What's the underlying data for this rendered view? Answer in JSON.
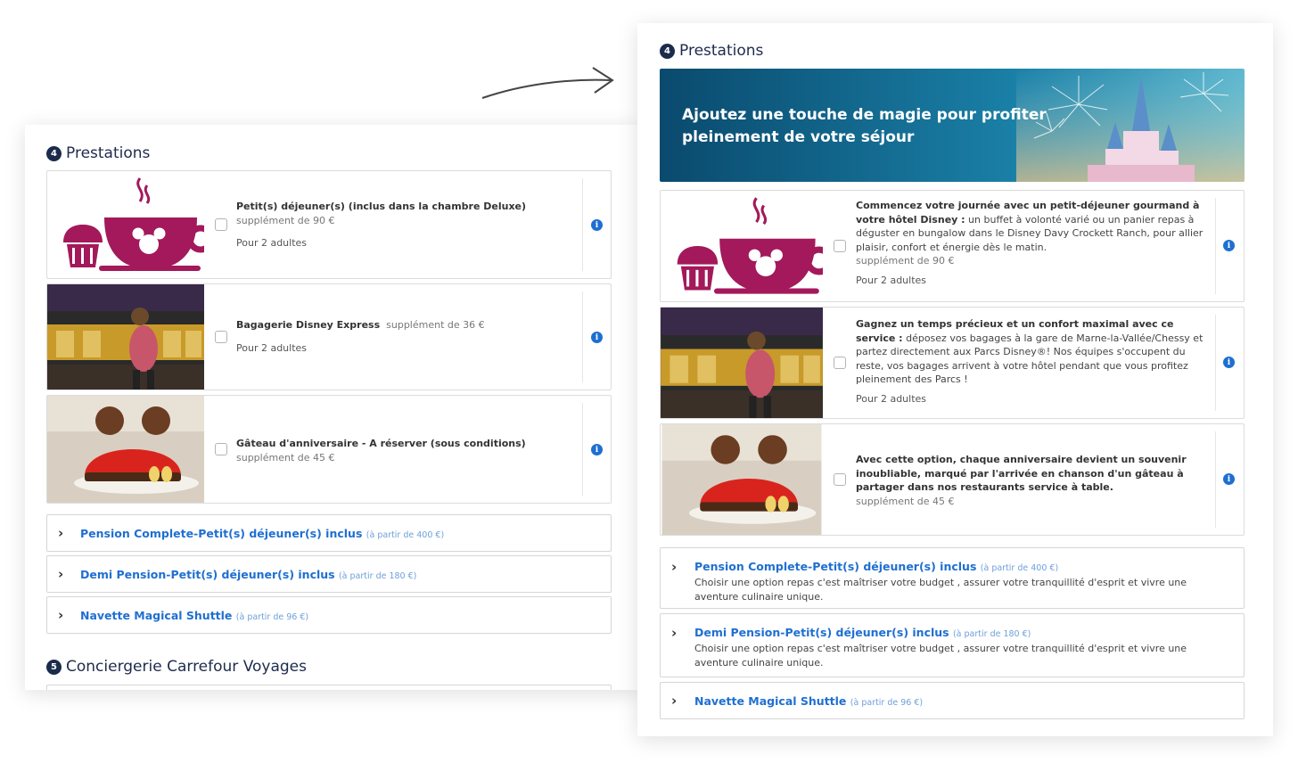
{
  "colors": {
    "navy": "#1b2b4b",
    "link_blue": "#1f6fd1",
    "price_blue": "#6ea0dc",
    "disney_wine": "#a3195b"
  },
  "before": {
    "section4": {
      "number": "4",
      "title": "Prestations"
    },
    "options": [
      {
        "title": "Petit(s) déjeuner(s) (inclus dans la chambre Deluxe)",
        "price": "supplément de 90 €",
        "persons": "Pour 2 adultes",
        "image": "breakfast-icon"
      },
      {
        "title": "Bagagerie Disney Express",
        "price": "supplément de 36 €",
        "persons": "Pour 2 adultes",
        "image": "disney-express-photo"
      },
      {
        "title": "Gâteau d'anniversaire - A réserver (sous conditions)",
        "price": "supplément de 45 €",
        "persons": "",
        "image": "mickey-cake-photo"
      }
    ],
    "accordions": [
      {
        "title": "Pension Complete-Petit(s) déjeuner(s) inclus",
        "price": "(à partir de 400 €)"
      },
      {
        "title": "Demi Pension-Petit(s) déjeuner(s) inclus",
        "price": "(à partir de 180 €)"
      },
      {
        "title": "Navette Magical Shuttle",
        "price": "(à partir de 96 €)"
      }
    ],
    "section5": {
      "number": "5",
      "title": "Conciergerie Carrefour Voyages"
    }
  },
  "after": {
    "section4": {
      "number": "4",
      "title": "Prestations"
    },
    "banner": {
      "line1": "Ajoutez une touche de magie pour profiter",
      "line2": "pleinement de votre séjour"
    },
    "options": [
      {
        "lead": "Commencez votre journée avec un petit-déjeuner gourmand à votre hôtel Disney :",
        "body": " un buffet à volonté varié ou un panier repas à déguster en bungalow dans le Disney Davy Crockett Ranch, pour allier plaisir, confort et énergie dès le matin.",
        "price": "supplément de 90 €",
        "persons": "Pour 2 adultes"
      },
      {
        "lead": "Gagnez un temps précieux et un confort maximal avec ce service :",
        "body": " déposez vos bagages à la gare de Marne-la-Vallée/Chessy et partez directement aux Parcs Disney®! Nos équipes s'occupent du reste, vos bagages arrivent à votre hôtel pendant que vous profitez pleinement des Parcs !",
        "price": "",
        "persons": "Pour 2 adultes"
      },
      {
        "lead": "Avec cette option, chaque anniversaire devient un souvenir inoubliable, marqué par l'arrivée en chanson d'un gâteau à partager dans nos restaurants service à table.",
        "body": "",
        "price": "supplément de 45 €",
        "persons": ""
      }
    ],
    "accordions": [
      {
        "title": "Pension Complete-Petit(s) déjeuner(s) inclus",
        "price": "(à partir de 400 €)",
        "desc": "Choisir une option repas c'est maîtriser votre budget , assurer votre tranquillité d'esprit et vivre une aventure culinaire unique."
      },
      {
        "title": "Demi Pension-Petit(s) déjeuner(s) inclus",
        "price": "(à partir de 180 €)",
        "desc": "Choisir une option repas c'est maîtriser votre budget , assurer votre tranquillité d'esprit et vivre une aventure culinaire unique."
      },
      {
        "title": "Navette Magical Shuttle",
        "price": "(à partir de 96 €)",
        "desc": ""
      }
    ]
  },
  "icons": {
    "info": "i",
    "chevron": "›"
  }
}
